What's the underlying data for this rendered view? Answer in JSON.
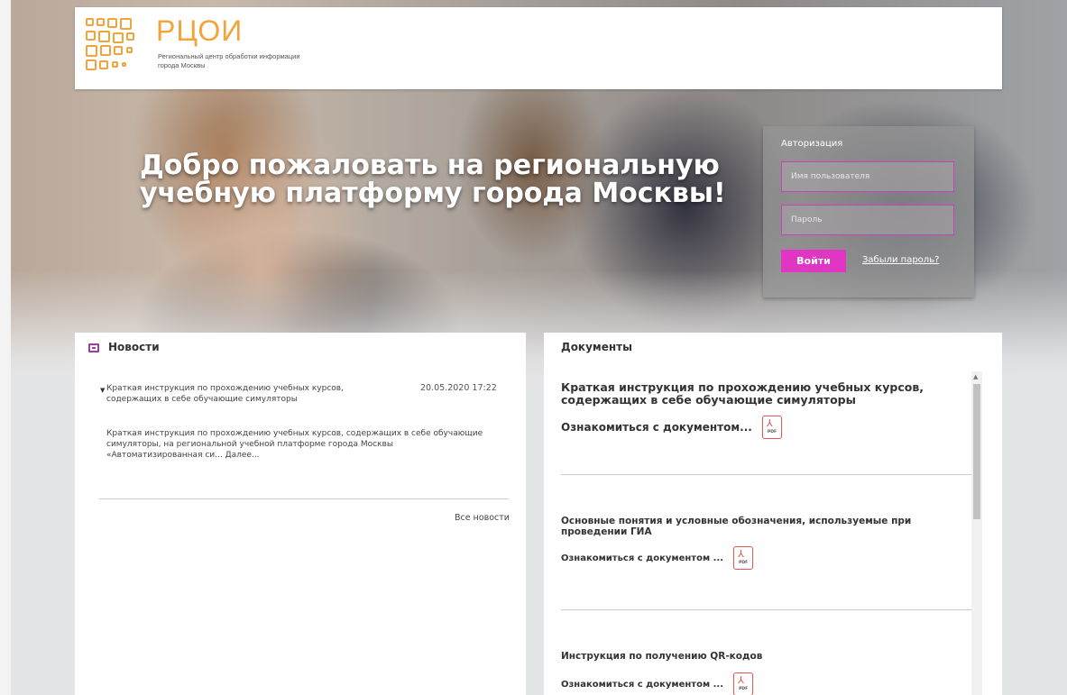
{
  "brand": {
    "title": "РЦОИ",
    "subtitle_line1": "Региональный центр обработки информации",
    "subtitle_line2": "города Москвы",
    "accent_color": "#f0a43a"
  },
  "hero": {
    "welcome": "Добро пожаловать на региональную учебную платформу города Москвы!"
  },
  "auth": {
    "title": "Авторизация",
    "username_placeholder": "Имя пользователя",
    "password_placeholder": "Пароль",
    "login_label": "Войти",
    "forgot_label": "Забыли пароль?",
    "button_color": "#e036c3"
  },
  "news": {
    "title": "Новости",
    "icon": "newspaper-icon",
    "items": [
      {
        "title": "Краткая инструкция по прохождению учебных курсов, содержащих в себе обучающие симуляторы",
        "date": "20.05.2020 17:22",
        "text": "Краткая инструкция по прохождению учебных курсов, содержащих в себе обучающие симуляторы, на региональной учебной платформе города Москвы «Автоматизированная си... Далее..."
      }
    ],
    "all_news": "Все новости"
  },
  "documents": {
    "title": "Документы",
    "items": [
      {
        "title": "Краткая инструкция по прохождению учебных курсов, содержащих в себе обучающие симуляторы",
        "link": "Ознакомиться с документом..."
      },
      {
        "title": "Основные понятия и условные обозначения, используемые при проведении ГИА",
        "link": "Ознакомиться с документом ..."
      },
      {
        "title": "Инструкция по получению QR-кодов",
        "link": "Ознакомиться с документом ..."
      }
    ],
    "pdf_label": "PDF"
  }
}
